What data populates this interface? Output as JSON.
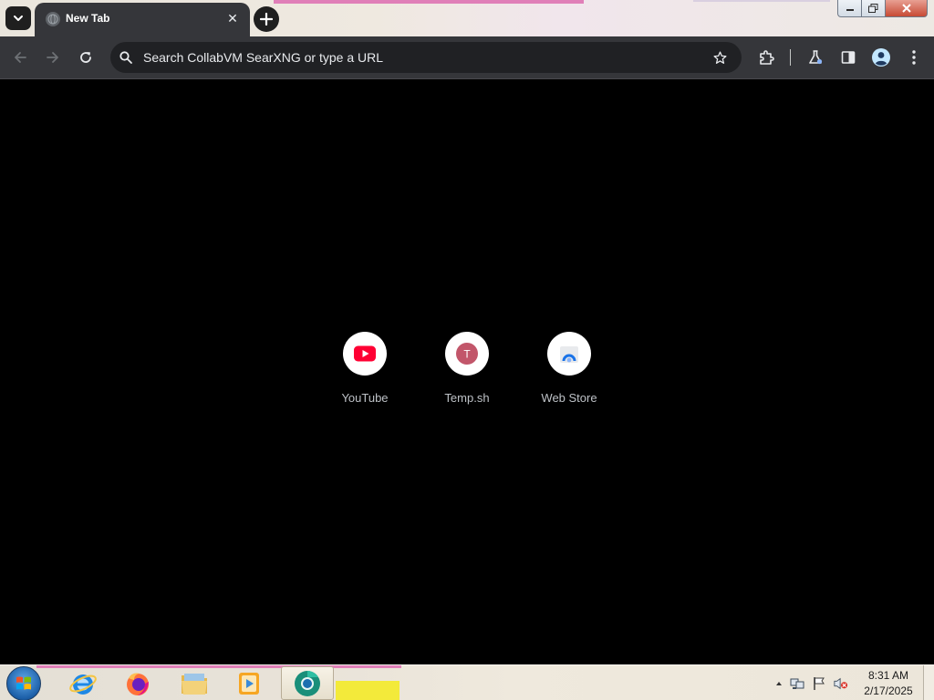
{
  "tab": {
    "title": "New Tab",
    "close_glyph": "✕"
  },
  "omnibox": {
    "placeholder": "Search CollabVM SearXNG or type a URL"
  },
  "shortcuts": [
    {
      "label": "YouTube",
      "icon": "youtube-icon"
    },
    {
      "label": "Temp.sh",
      "icon": "letter-avatar-icon",
      "letter": "T",
      "color": "#c2566a"
    },
    {
      "label": "Web Store",
      "icon": "web-store-icon"
    }
  ],
  "taskbar": {
    "apps": [
      "internet-explorer-icon",
      "firefox-icon",
      "file-explorer-icon",
      "media-player-icon",
      "chrome-icon"
    ]
  },
  "clock": {
    "time": "8:31 AM",
    "date": "2/17/2025"
  },
  "colors": {
    "toolbar_bg": "#35363a",
    "omnibox_bg": "#202124",
    "content_bg": "#000000",
    "youtube_red": "#ff0033"
  }
}
